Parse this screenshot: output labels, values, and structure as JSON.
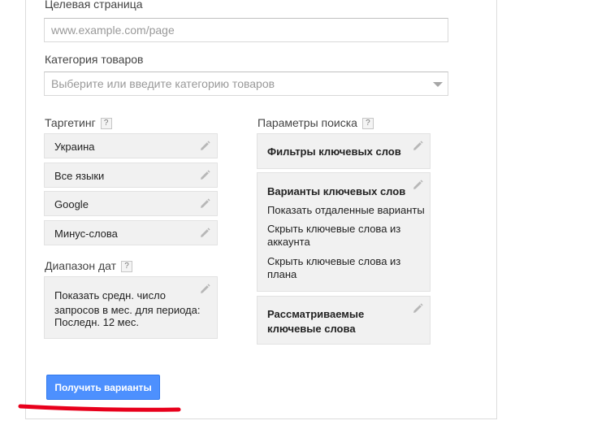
{
  "landing_page": {
    "label": "Целевая страница",
    "placeholder": "www.example.com/page"
  },
  "product_category": {
    "label": "Категория товаров",
    "placeholder": "Выберите или введите категорию товаров"
  },
  "targeting": {
    "label": "Таргетинг",
    "help": "?",
    "items": [
      "Украина",
      "Все языки",
      "Google",
      "Минус-слова"
    ]
  },
  "date_range": {
    "label": "Диапазон дат",
    "help": "?",
    "lines": [
      "Показать средн. число",
      "запросов в мес. для периода:",
      "Последн. 12 мес."
    ]
  },
  "search_params": {
    "label": "Параметры поиска",
    "help": "?",
    "keyword_filters": "Фильтры ключевых слов",
    "keyword_options": {
      "title": "Варианты ключевых слов",
      "lines": [
        "Показать отдаленные варианты",
        "Скрыть ключевые слова из",
        "аккаунта",
        "Скрыть ключевые слова из",
        "плана"
      ]
    },
    "considered_keywords": [
      "Рассматриваемые",
      "ключевые слова"
    ]
  },
  "submit_button": "Получить варианты",
  "icons": {
    "edit": "pencil-icon",
    "help": "question-mark-icon",
    "dropdown": "chevron-down-icon"
  },
  "colors": {
    "button": "#4d90fe",
    "annotation": "#e8001c",
    "box_bg": "#f1f1f1"
  }
}
